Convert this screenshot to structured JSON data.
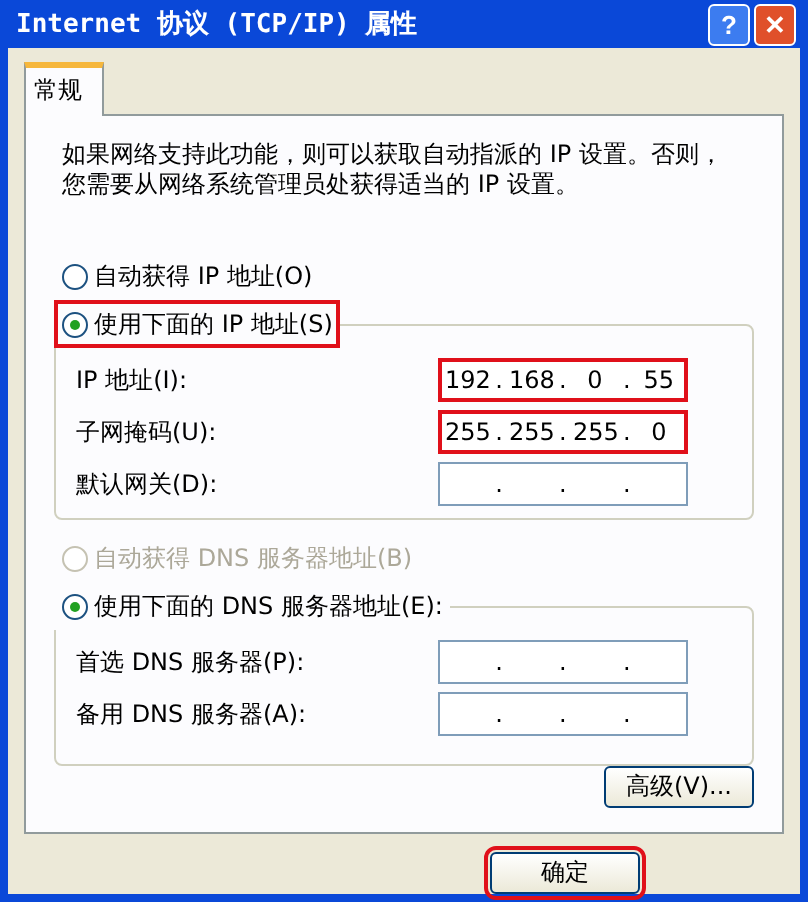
{
  "window": {
    "title": "Internet 协议 (TCP/IP) 属性",
    "buttons": [
      {
        "kind": "help",
        "label": "?"
      },
      {
        "kind": "close",
        "label": "✕"
      }
    ]
  },
  "tabs": [
    {
      "label": "常规",
      "selected": true
    }
  ],
  "intro": "如果网络支持此功能，则可以获取自动指派的 IP 设置。否则，您需要从网络系统管理员处获得适当的 IP 设置。",
  "ip_section": {
    "options": [
      {
        "label": "自动获得 IP 地址(O)",
        "selected": false,
        "disabled": false,
        "highlighted": false
      },
      {
        "label": "使用下面的 IP 地址(S)",
        "selected": true,
        "disabled": false,
        "highlighted": true
      }
    ],
    "fields": [
      {
        "label": "IP 地址(I):",
        "separator": ".",
        "segments": [
          "192",
          "168",
          "0",
          "55"
        ],
        "highlighted": true
      },
      {
        "label": "子网掩码(U):",
        "separator": ".",
        "segments": [
          "255",
          "255",
          "255",
          "0"
        ],
        "highlighted": true
      },
      {
        "label": "默认网关(D):",
        "separator": ".",
        "highlighted": false
      }
    ]
  },
  "dns_section": {
    "options": [
      {
        "label": "自动获得 DNS 服务器地址(B)",
        "selected": false,
        "disabled": true,
        "highlighted": false
      },
      {
        "label": "使用下面的 DNS 服务器地址(E):",
        "selected": true,
        "disabled": false,
        "highlighted": false
      }
    ],
    "fields": [
      {
        "label": "首选 DNS 服务器(P):",
        "separator": ".",
        "highlighted": false
      },
      {
        "label": "备用 DNS 服务器(A):",
        "separator": ".",
        "highlighted": false
      }
    ]
  },
  "advanced_button": "高级(V)...",
  "footer_buttons": [
    {
      "label": "确定",
      "highlighted": true
    }
  ]
}
